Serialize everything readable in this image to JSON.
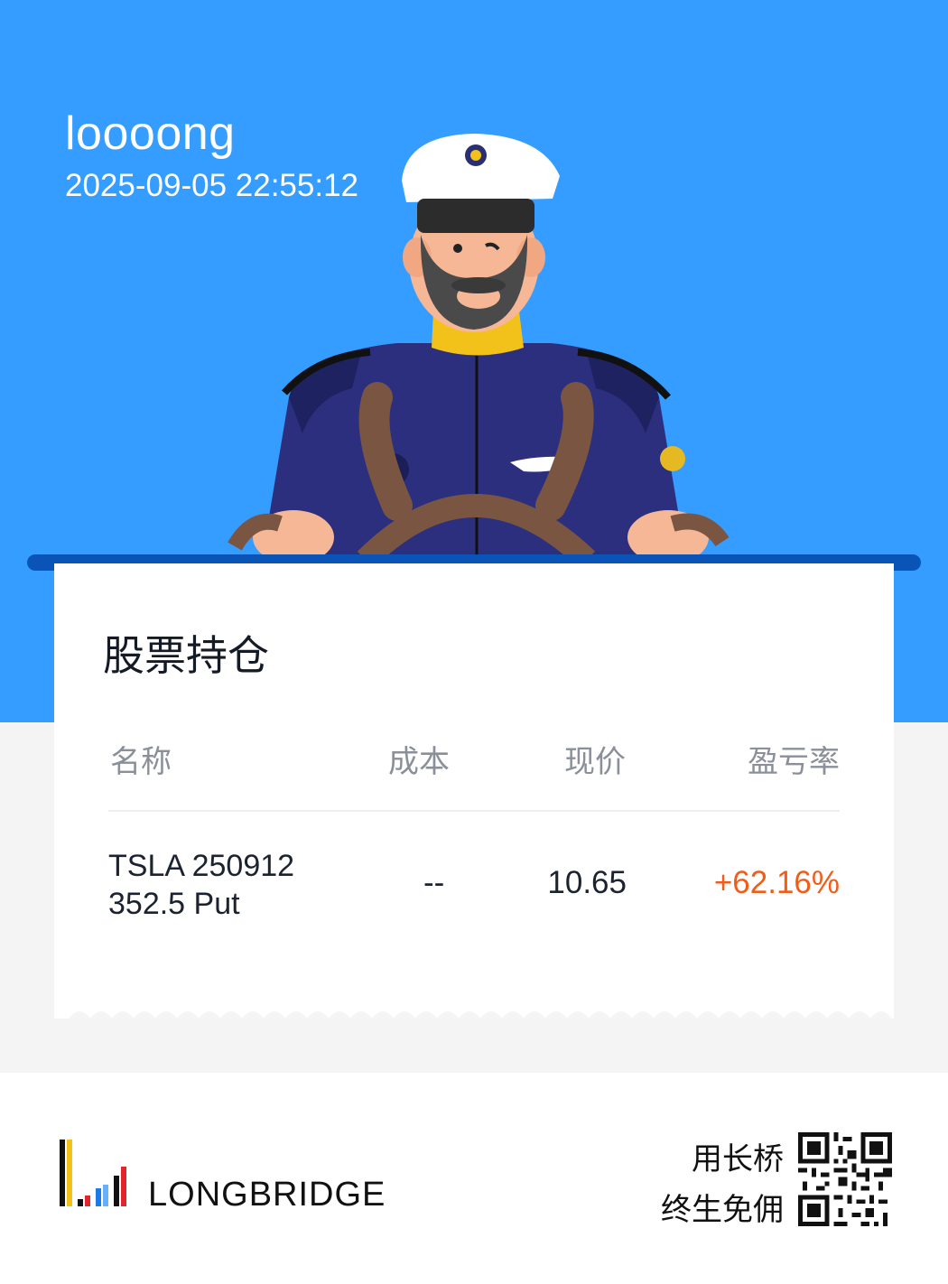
{
  "header": {
    "username": "loooong",
    "timestamp": "2025-09-05 22:55:12"
  },
  "holdings": {
    "title": "股票持仓",
    "columns": [
      "名称",
      "成本",
      "现价",
      "盈亏率"
    ],
    "rows": [
      {
        "name_line1": "TSLA 250912",
        "name_line2": "352.5 Put",
        "cost": "--",
        "price": "10.65",
        "pnl_rate": "+62.16%"
      }
    ]
  },
  "footer": {
    "brand": "LONGBRIDGE",
    "slogan_line1": "用长桥",
    "slogan_line2": "终生免佣"
  },
  "colors": {
    "hero_blue": "#359dff",
    "bar_blue": "#0a54b8",
    "gain_orange": "#f25c19"
  },
  "icons": [
    "captain-illustration",
    "longbridge-logo",
    "qr-code"
  ]
}
